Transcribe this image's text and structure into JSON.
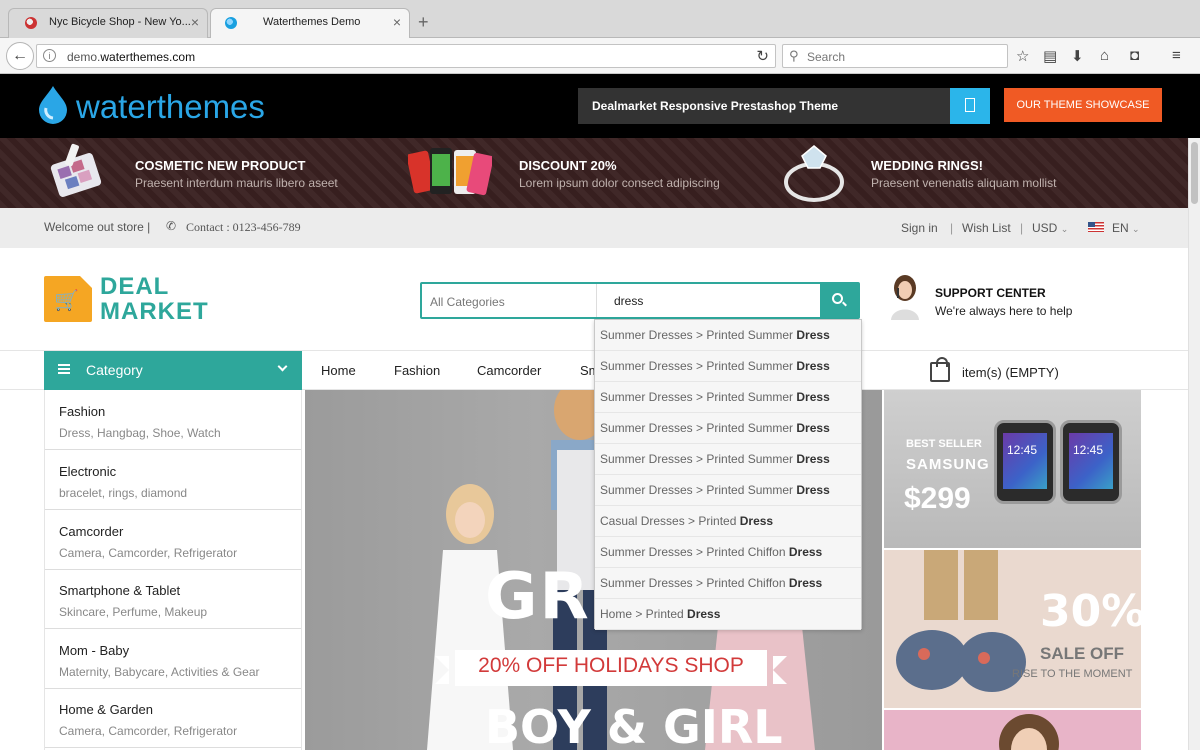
{
  "browser": {
    "tabs": [
      {
        "title": "Nyc Bicycle Shop - New Yo...",
        "active": false
      },
      {
        "title": "Waterthemes Demo",
        "active": true
      }
    ],
    "url_prefix": "demo.",
    "url_domain": "waterthemes.com",
    "search_placeholder": "Search"
  },
  "topbar": {
    "logo_text": "waterthemes",
    "theme_label": "Dealmarket Responsive Prestashop Theme",
    "showcase_label": "OUR THEME SHOWCASE"
  },
  "promos": [
    {
      "title": "COSMETIC NEW PRODUCT",
      "subtitle": "Praesent interdum mauris libero aseet"
    },
    {
      "title": "DISCOUNT 20%",
      "subtitle": "Lorem ipsum dolor consect adipiscing"
    },
    {
      "title": "WEDDING RINGS!",
      "subtitle": "Praesent venenatis aliquam mollist"
    }
  ],
  "welcome": {
    "text": "Welcome out store |",
    "contact": "Contact : 0123-456-789",
    "sign_in": "Sign in",
    "sep1": "|",
    "wish_list": "Wish List",
    "sep2": "|",
    "currency": "USD",
    "language": "EN"
  },
  "header": {
    "logo_line1": "DEAL",
    "logo_line2": "MARKET",
    "category_select": "All Categories",
    "search_value": "dress",
    "support_title": "SUPPORT CENTER",
    "support_sub": "We're always here to help"
  },
  "nav": {
    "category_label": "Category",
    "items": [
      "Home",
      "Fashion",
      "Camcorder",
      "Sm"
    ],
    "cart_label": "item(s) (EMPTY)"
  },
  "categories": [
    {
      "name": "Fashion",
      "desc": "Dress, Hangbag, Shoe, Watch"
    },
    {
      "name": "Electronic",
      "desc": "bracelet, rings, diamond"
    },
    {
      "name": "Camcorder",
      "desc": "Camera, Camcorder, Refrigerator"
    },
    {
      "name": "Smartphone & Tablet",
      "desc": "Skincare, Perfume, Makeup"
    },
    {
      "name": "Mom - Baby",
      "desc": "Maternity, Babycare, Activities & Gear"
    },
    {
      "name": "Home & Garden",
      "desc": "Camera, Camcorder, Refrigerator"
    }
  ],
  "hero": {
    "headline": "GRO",
    "ribbon": "20% OFF HOLIDAYS SHOP",
    "subline": "BOY & GIRL"
  },
  "side_banners": {
    "samsung_tag": "BEST SELLER",
    "samsung_brand": "SAMSUNG",
    "samsung_price": "$299",
    "watch_time": "12:45",
    "sale_pct": "30%",
    "sale_off": "SALE OFF",
    "sale_sub": "RISE TO THE MOMENT"
  },
  "autocomplete": [
    {
      "prefix": "Summer Dresses > Printed Summer ",
      "match": "Dress"
    },
    {
      "prefix": "Summer Dresses > Printed Summer ",
      "match": "Dress"
    },
    {
      "prefix": "Summer Dresses > Printed Summer ",
      "match": "Dress"
    },
    {
      "prefix": "Summer Dresses > Printed Summer ",
      "match": "Dress"
    },
    {
      "prefix": "Summer Dresses > Printed Summer ",
      "match": "Dress"
    },
    {
      "prefix": "Summer Dresses > Printed Summer ",
      "match": "Dress"
    },
    {
      "prefix": "Casual Dresses > Printed ",
      "match": "Dress"
    },
    {
      "prefix": "Summer Dresses > Printed Chiffon ",
      "match": "Dress"
    },
    {
      "prefix": "Summer Dresses > Printed Chiffon ",
      "match": "Dress"
    },
    {
      "prefix": "Home > Printed ",
      "match": "Dress"
    }
  ],
  "colors": {
    "accent": "#2ea79b",
    "brand_blue": "#2aa6e6",
    "showcase_orange": "#f05a24",
    "logo_orange": "#f5a623"
  }
}
